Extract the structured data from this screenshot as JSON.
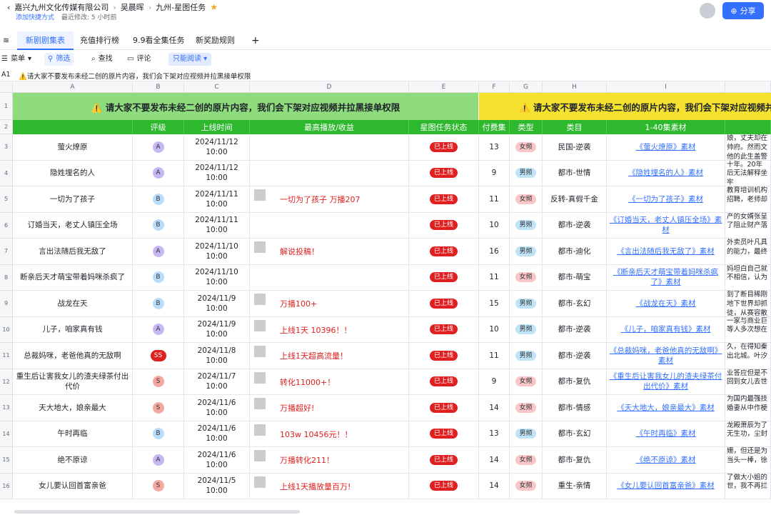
{
  "breadcrumb": [
    "嘉兴九州文化传媒有限公司",
    "吴晨晖",
    "九州-星图任务"
  ],
  "sub": {
    "shortcut": "添加快捷方式",
    "modified": "最近修改: 5 小时前"
  },
  "share_label": "分享",
  "tabs": [
    "新剧剧集表",
    "充值排行榜",
    "9.9看全集任务",
    "新奖励规则"
  ],
  "toolbar": {
    "menu": "菜单",
    "filter": "筛选",
    "find": "查找",
    "comment": "评论",
    "readonly": "只能阅读"
  },
  "cellref": {
    "ref": "A1",
    "content": "⚠️请大家不要发布未经二创的原片内容，我们会下架对应视频并拉黑接单权限"
  },
  "banner_text": "⚠️ 请大家不要发布未经二创的原片内容，我们会下架对应视频并拉黑接单权限",
  "col_letters": [
    "A",
    "B",
    "C",
    "D",
    "E",
    "F",
    "G",
    "H",
    "I"
  ],
  "headers": [
    "",
    "评级",
    "上线时间",
    "最高播放/收益",
    "星图任务状态",
    "付费集",
    "类型",
    "类目",
    "1-40集素材"
  ],
  "row_numbers": [
    "1",
    "2",
    "3",
    "4",
    "5",
    "6",
    "7",
    "8",
    "9",
    "10",
    "11",
    "12",
    "13",
    "14",
    "15",
    "16"
  ],
  "grade_colors": {
    "A": "#c7b7f5",
    "B": "#b9dcfb",
    "S": "#f3a8a0",
    "SS": "#e02020"
  },
  "type_colors": {
    "女频": "#f9c7c7",
    "男频": "#bfe4f8"
  },
  "rows": [
    {
      "title": "萤火燎原",
      "grade": "A",
      "date": "2024/11/12 10:00",
      "proof": "",
      "status": "已上线",
      "paid": "13",
      "ptype": "女频",
      "cat": "民国-逆袭",
      "mat": "《萤火燎原》素材",
      "side": "娘，丈夫却在帅府。然而文他的此生盖警"
    },
    {
      "title": "隐姓埋名的人",
      "grade": "A",
      "date": "2024/11/12 10:00",
      "proof": "",
      "status": "已上线",
      "paid": "9",
      "ptype": "男频",
      "cat": "都市-世情",
      "mat": "《隐姓埋名的人》素材",
      "side": "十年。20年后无法解释坐牢"
    },
    {
      "title": "一切为了孩子",
      "grade": "B",
      "date": "2024/11/11 10:00",
      "proof": "一切为了孩子 万播207",
      "status": "已上线",
      "paid": "11",
      "ptype": "女频",
      "cat": "反转-真假千金",
      "mat": "《一切为了孩子》素材",
      "side": "教育培训机构招聘，老师却"
    },
    {
      "title": "订婚当天，老丈人镇压全场",
      "grade": "B",
      "date": "2024/11/11 10:00",
      "proof": "",
      "status": "已上线",
      "paid": "10",
      "ptype": "男频",
      "cat": "都市-逆袭",
      "mat": "《订婚当天，老丈人镇压全场》素材",
      "side": "产的女婿张呈了阻止财产落"
    },
    {
      "title": "言出法随后我无敌了",
      "grade": "A",
      "date": "2024/11/10 10:00",
      "proof": "解说投稿！",
      "status": "已上线",
      "paid": "16",
      "ptype": "男频",
      "cat": "都市-迪化",
      "mat": "《言出法随后我无敌了》素材",
      "side": "外卖员叶凡具的能力，最终"
    },
    {
      "title": "断亲后天才萌宝带着妈咪杀疯了",
      "grade": "B",
      "date": "2024/11/10 10:00",
      "proof": "",
      "status": "已上线",
      "paid": "11",
      "ptype": "女频",
      "cat": "都市-萌宝",
      "mat": "《断亲后天才萌宝带着妈咪杀疯了》素材",
      "side": "妈坦白自己就不相信，认为"
    },
    {
      "title": "战龙在天",
      "grade": "B",
      "date": "2024/11/9 10:00",
      "proof": "万播100+",
      "status": "已上线",
      "paid": "15",
      "ptype": "男频",
      "cat": "都市-玄幻",
      "mat": "《战龙在天》素材",
      "side": "到了断目稀刚地下世界却抓徒，从赛容散"
    },
    {
      "title": "儿子，咱家真有钱",
      "grade": "A",
      "date": "2024/11/9 10:00",
      "proof": "上线1天 10396！！",
      "status": "已上线",
      "paid": "10",
      "ptype": "男频",
      "cat": "都市-逆袭",
      "mat": "《儿子，咱家真有钱》素材",
      "side": "一家与商业巨等人多次想在"
    },
    {
      "title": "总裁妈咪，老爸他真的无敌啊",
      "grade": "SS",
      "date": "2024/11/8 10:00",
      "proof": "上线1天超高流量！",
      "status": "已上线",
      "paid": "11",
      "ptype": "男频",
      "cat": "都市-逆袭",
      "mat": "《总裁妈咪，老爸他真的无敌啊》素材",
      "side": "久，在得知秦出北城。叶汐"
    },
    {
      "title": "重生后让害我女儿的渣夫绿茶付出代价",
      "grade": "S",
      "date": "2024/11/7 10:00",
      "proof": "转化11000+！",
      "status": "已上线",
      "paid": "9",
      "ptype": "女频",
      "cat": "都市-复仇",
      "mat": "《重生后让害我女儿的渣夫绿茶付出代价》素材",
      "side": "业答应但是不回到女儿去世"
    },
    {
      "title": "天大地大，娘亲最大",
      "grade": "S",
      "date": "2024/11/6 10:00",
      "proof": "万播超好!",
      "status": "已上线",
      "paid": "14",
      "ptype": "女频",
      "cat": "都市-情感",
      "mat": "《天大地大，娘亲最大》素材",
      "side": "为国内最强技婚妻从中作梗"
    },
    {
      "title": "午时再临",
      "grade": "B",
      "date": "2024/11/6 10:00",
      "proof": "103w 10456元！！",
      "status": "已上线",
      "paid": "13",
      "ptype": "男频",
      "cat": "都市-玄幻",
      "mat": "《午时再临》素材",
      "side": "龙殿萧辰为了无生功，尘封"
    },
    {
      "title": "绝不原谅",
      "grade": "A",
      "date": "2024/11/6 10:00",
      "proof": "万播转化211！",
      "status": "已上线",
      "paid": "14",
      "ptype": "女频",
      "cat": "都市-复仇",
      "mat": "《绝不原谅》素材",
      "side": "姗，但还是为当头一棒，徐"
    },
    {
      "title": "女儿要认回首富亲爸",
      "grade": "S",
      "date": "2024/11/5 10:00",
      "proof": "上线1天播放量百万!",
      "status": "已上线",
      "paid": "14",
      "ptype": "女频",
      "cat": "重生-亲情",
      "mat": "《女儿要认回首富亲爸》素材",
      "side": "了做大小姐的世，我不再拦"
    }
  ]
}
